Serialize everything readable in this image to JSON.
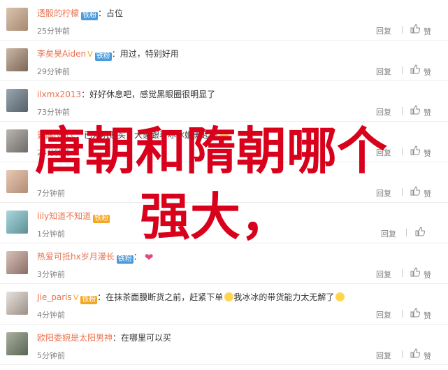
{
  "comments": [
    {
      "name": "透骰的柠檬",
      "badge": "",
      "vbadge": "铁粉",
      "vip": "",
      "text": "占位",
      "time": "25分钟前"
    },
    {
      "name": "李矣昊Aiden",
      "badge": "V",
      "vbadge": "铁粉",
      "vip": "",
      "text": "用过，特别好用",
      "time": "29分钟前"
    },
    {
      "name": "ilxmx2013",
      "badge": "",
      "vbadge": "",
      "vip": "",
      "text": "好好休息吧，感觉黑眼圈很明显了",
      "time": "73分钟前"
    },
    {
      "name": "露露lvecc",
      "badge": "",
      "vbadge": "",
      "vip": "",
      "text": "已入坑购买，大家跟着冰冰姐美起来",
      "time": "24分钟前"
    },
    {
      "name": "",
      "badge": "",
      "vbadge": "",
      "vip": "",
      "text": "",
      "time": "7分钟前"
    },
    {
      "name": "lily知道不知道",
      "badge": "",
      "vbadge": "",
      "vip": "铁粉",
      "text": "",
      "time": "1分钟前"
    },
    {
      "name": "热爱可抵hx岁月漫长",
      "badge": "",
      "vbadge": "铁粉",
      "vip": "",
      "text": "",
      "time": "3分钟前"
    },
    {
      "name": "Jie_paris",
      "badge": "V",
      "vbadge": "",
      "vip": "铁粉",
      "text": "在抹茶面膜断货之前，赶紧下单",
      "text2": "我冰冰的带货能力太无解了",
      "time": "4分钟前"
    },
    {
      "name": "欧阳委婉是太阳男神",
      "badge": "",
      "vbadge": "",
      "vip": "",
      "text": "在哪里可以买",
      "time": "5分钟前"
    }
  ],
  "actions": {
    "reply_label": "回复"
  },
  "overlay": {
    "line1": "唐朝和隋朝哪个",
    "line2": "强大，"
  },
  "colors": {
    "name": "#eb7350",
    "overlay": "#d8001a",
    "time": "#808080"
  }
}
